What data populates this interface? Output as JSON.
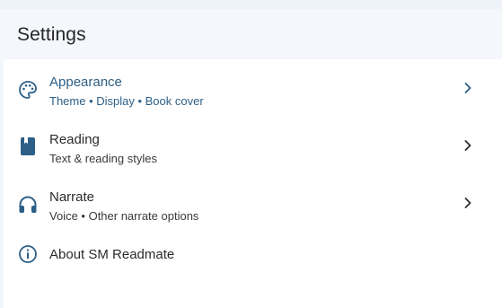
{
  "header": {
    "title": "Settings"
  },
  "items": [
    {
      "label": "Appearance",
      "sub": "Theme • Display • Book cover",
      "icon": "palette-icon",
      "active": true
    },
    {
      "label": "Reading",
      "sub": "Text & reading styles",
      "icon": "book-icon"
    },
    {
      "label": "Narrate",
      "sub": "Voice • Other narrate options",
      "icon": "headphones-icon"
    },
    {
      "label": "About SM Readmate",
      "icon": "info-icon"
    }
  ],
  "colors": {
    "accent": "#2d5f86",
    "header_bg": "#f4f7fb",
    "panel_bg": "#ffffff"
  }
}
